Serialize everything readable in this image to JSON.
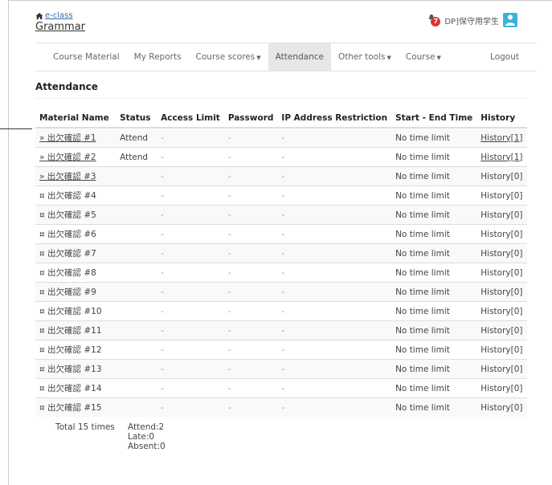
{
  "header": {
    "home_label": "e-class",
    "course_title": "Grammar",
    "notification_count": "7",
    "user_name": "DP]保守用学生"
  },
  "nav": {
    "items": [
      "Course Material",
      "My Reports",
      "Course scores",
      "Attendance",
      "Other tools",
      "Course"
    ],
    "logout": "Logout"
  },
  "page": {
    "heading": "Attendance"
  },
  "table": {
    "columns": [
      "Material Name",
      "Status",
      "Access Limit",
      "Password",
      "IP Address Restriction",
      "Start - End Time",
      "History"
    ],
    "rows": [
      {
        "name": "» 出欠確認 #1",
        "status": "Attend",
        "access": "-",
        "password": "-",
        "ip": "-",
        "time": "No time limit",
        "history": "History[1]"
      },
      {
        "name": "» 出欠確認 #2",
        "status": "Attend",
        "access": "-",
        "password": "-",
        "ip": "-",
        "time": "No time limit",
        "history": "History[1]"
      },
      {
        "name": "» 出欠確認 #3",
        "status": "",
        "access": "-",
        "password": "-",
        "ip": "-",
        "time": "No time limit",
        "history": "History[0]"
      },
      {
        "name": "¤ 出欠確認 #4",
        "status": "",
        "access": "-",
        "password": "-",
        "ip": "-",
        "time": "No time limit",
        "history": "History[0]"
      },
      {
        "name": "¤ 出欠確認 #5",
        "status": "",
        "access": "-",
        "password": "-",
        "ip": "-",
        "time": "No time limit",
        "history": "History[0]"
      },
      {
        "name": "¤ 出欠確認 #6",
        "status": "",
        "access": "-",
        "password": "-",
        "ip": "-",
        "time": "No time limit",
        "history": "History[0]"
      },
      {
        "name": "¤ 出欠確認 #7",
        "status": "",
        "access": "-",
        "password": "-",
        "ip": "-",
        "time": "No time limit",
        "history": "History[0]"
      },
      {
        "name": "¤ 出欠確認 #8",
        "status": "",
        "access": "-",
        "password": "-",
        "ip": "-",
        "time": "No time limit",
        "history": "History[0]"
      },
      {
        "name": "¤ 出欠確認 #9",
        "status": "",
        "access": "-",
        "password": "-",
        "ip": "-",
        "time": "No time limit",
        "history": "History[0]"
      },
      {
        "name": "¤ 出欠確認 #10",
        "status": "",
        "access": "-",
        "password": "-",
        "ip": "-",
        "time": "No time limit",
        "history": "History[0]"
      },
      {
        "name": "¤ 出欠確認 #11",
        "status": "",
        "access": "-",
        "password": "-",
        "ip": "-",
        "time": "No time limit",
        "history": "History[0]"
      },
      {
        "name": "¤ 出欠確認 #12",
        "status": "",
        "access": "-",
        "password": "-",
        "ip": "-",
        "time": "No time limit",
        "history": "History[0]"
      },
      {
        "name": "¤ 出欠確認 #13",
        "status": "",
        "access": "-",
        "password": "-",
        "ip": "-",
        "time": "No time limit",
        "history": "History[0]"
      },
      {
        "name": "¤ 出欠確認 #14",
        "status": "",
        "access": "-",
        "password": "-",
        "ip": "-",
        "time": "No time limit",
        "history": "History[0]"
      },
      {
        "name": "¤ 出欠確認 #15",
        "status": "",
        "access": "-",
        "password": "-",
        "ip": "-",
        "time": "No time limit",
        "history": "History[0]"
      }
    ]
  },
  "summary": {
    "total": "Total  15 times",
    "attend": "Attend:2",
    "late": "Late:0",
    "absent": "Absent:0"
  },
  "colors": {
    "link": "#2a6bb5",
    "badge": "#d9352f",
    "user_icon": "#3bb4d8",
    "active_tab": "#e7e7e7"
  },
  "icons": {
    "home": "home-icon",
    "notification": "bell-icon",
    "user": "user-icon"
  }
}
